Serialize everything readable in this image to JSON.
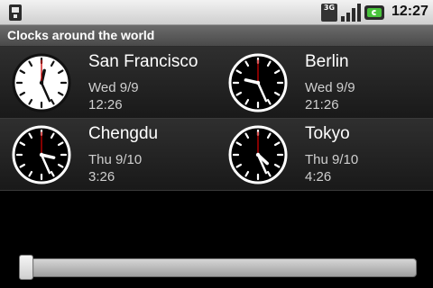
{
  "status_bar": {
    "time": "12:27",
    "network_label": "3G",
    "icons": [
      "notification-icon",
      "network-3g-icon",
      "signal-icon",
      "battery-charging-icon"
    ]
  },
  "app": {
    "title": "Clocks around the world"
  },
  "clocks": [
    {
      "city": "San Francisco",
      "date": "Wed 9/9",
      "time": "12:26",
      "style": "light"
    },
    {
      "city": "Berlin",
      "date": "Wed 9/9",
      "time": "21:26",
      "style": "dark"
    },
    {
      "city": "Chengdu",
      "date": "Thu 9/10",
      "time": "3:26",
      "style": "dark"
    },
    {
      "city": "Tokyo",
      "date": "Thu 9/10",
      "time": "4:26",
      "style": "dark"
    }
  ],
  "slider": {
    "value": 0.0
  },
  "colors": {
    "status_bar_bg": "#dcdcdc",
    "title_bar_bg": "#5a5a5a",
    "card_bg": "#222222",
    "second_hand": "#cc0000",
    "battery_charge": "#48c23b"
  }
}
